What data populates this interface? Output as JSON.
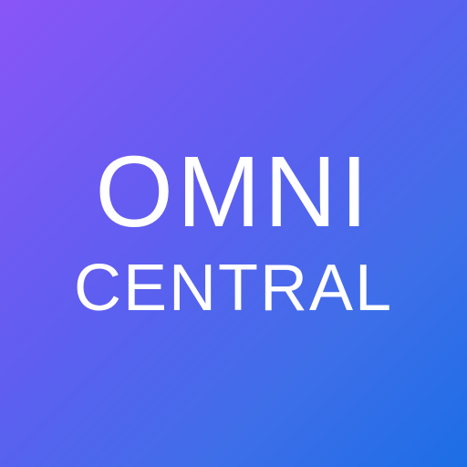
{
  "logo": {
    "line_1": "OMNI",
    "line_2": "CENTRAL"
  },
  "colors": {
    "gradient_start": "#8a55f6",
    "gradient_mid": "#5f5ef0",
    "gradient_end": "#1c6ee6",
    "text": "#ffffff"
  }
}
